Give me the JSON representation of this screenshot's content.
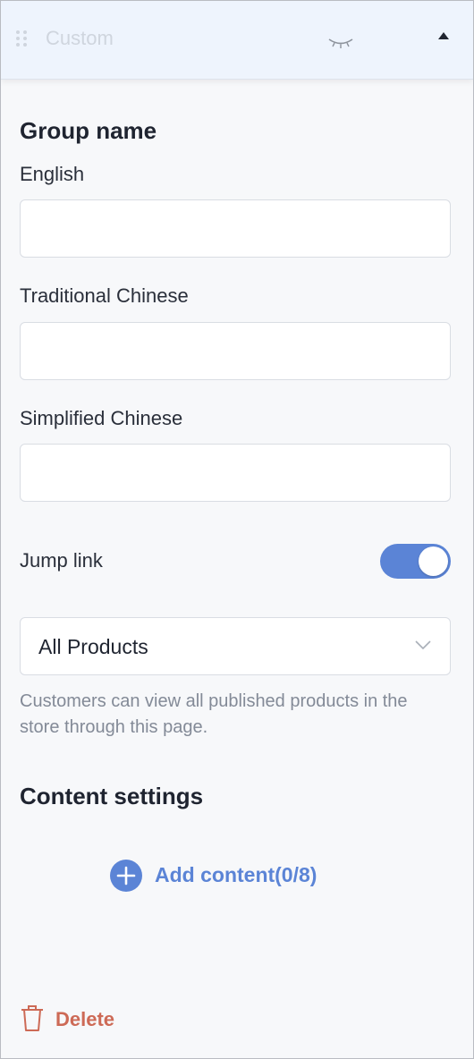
{
  "header": {
    "title": "Custom",
    "drag_icon": "drag-handle-icon",
    "visibility_icon": "eye-closed-icon",
    "collapse_icon": "caret-up-icon"
  },
  "group_name": {
    "title": "Group name",
    "fields": [
      {
        "label": "English",
        "value": "",
        "placeholder": ""
      },
      {
        "label": "Traditional Chinese",
        "value": "",
        "placeholder": ""
      },
      {
        "label": "Simplified Chinese",
        "value": "",
        "placeholder": ""
      }
    ]
  },
  "jump_link": {
    "label": "Jump link",
    "enabled": true,
    "selected": "All Products",
    "help_text": "Customers can view all published products in the store through this page."
  },
  "content_settings": {
    "title": "Content settings",
    "add_label": "Add content(0/8)"
  },
  "footer": {
    "delete_label": "Delete"
  },
  "colors": {
    "accent": "#5b84d6",
    "danger": "#cd6a56",
    "header_bg": "#eef4fd",
    "panel_bg": "#f7f8fa"
  }
}
